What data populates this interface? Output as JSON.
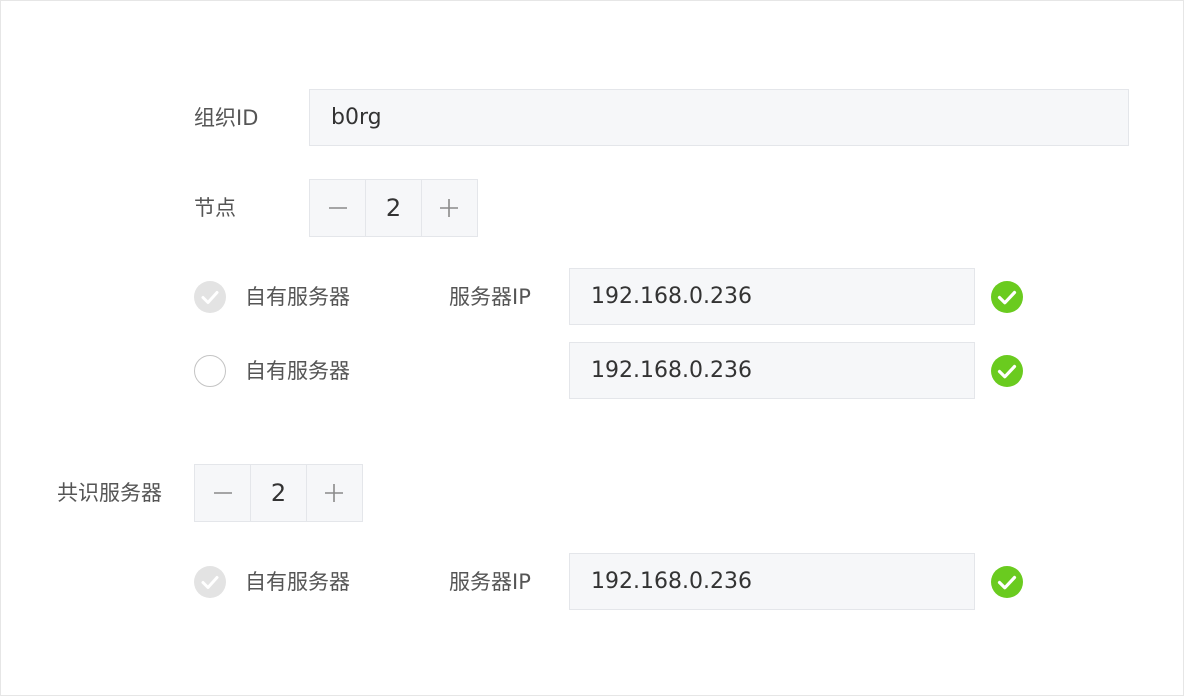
{
  "org": {
    "label": "组织ID",
    "value": "b0rg"
  },
  "nodes": {
    "label": "节点",
    "count": "2",
    "rows": [
      {
        "option_label": "自有服务器",
        "selected": true,
        "ip_label": "服务器IP",
        "ip": "192.168.0.236",
        "verified": true
      },
      {
        "option_label": "自有服务器",
        "selected": false,
        "ip_label": "",
        "ip": "192.168.0.236",
        "verified": true
      }
    ]
  },
  "consensus": {
    "label": "共识服务器",
    "count": "2",
    "rows": [
      {
        "option_label": "自有服务器",
        "selected": true,
        "ip_label": "服务器IP",
        "ip": "192.168.0.236",
        "verified": true
      }
    ]
  },
  "colors": {
    "success": "#6acb1f",
    "field_bg": "#f6f7f9",
    "field_border": "#e4e6ea",
    "radio_checked_bg": "#e3e3e3"
  },
  "icons": {
    "decrement": "minus-icon",
    "increment": "plus-icon",
    "verified": "check-circle-icon",
    "selected": "radio-checked-icon"
  }
}
